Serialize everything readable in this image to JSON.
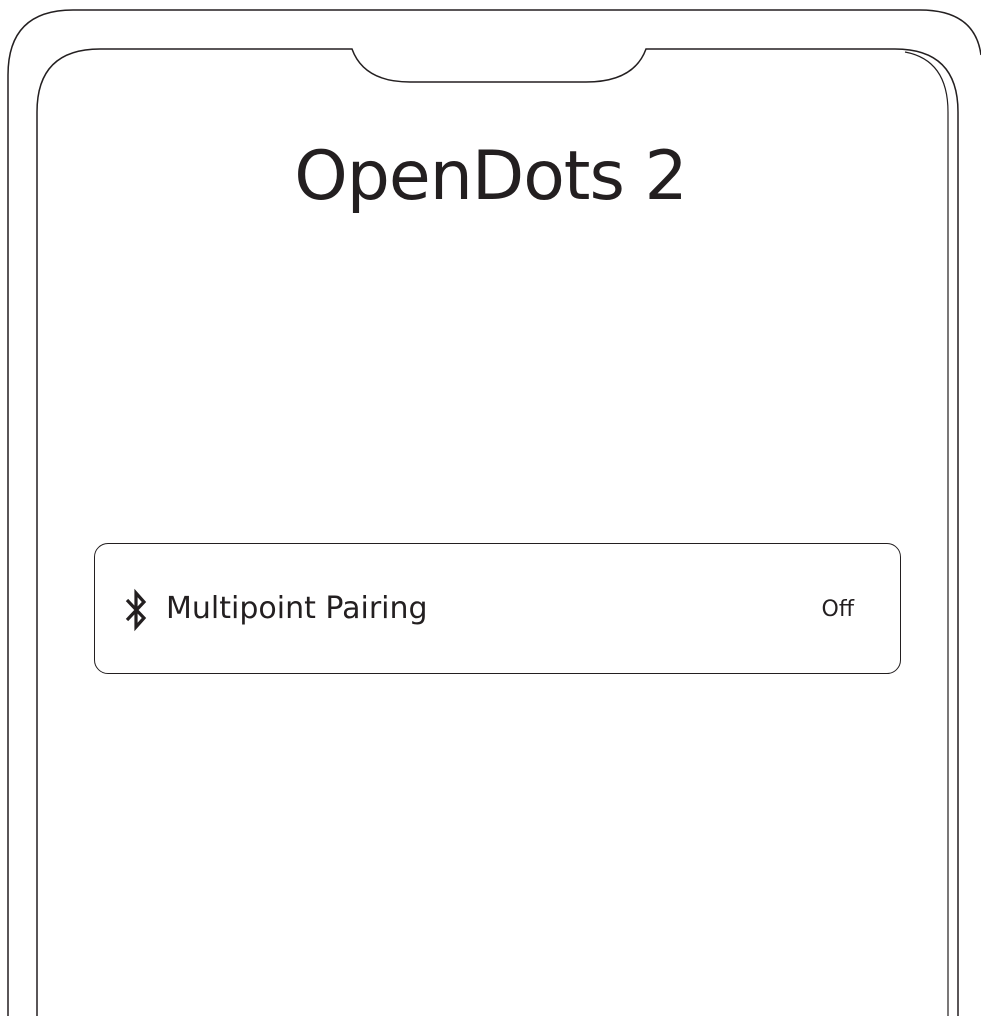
{
  "app": {
    "title": "OpenDots 2"
  },
  "settings": [
    {
      "icon": "bluetooth-icon",
      "label": "Multipoint Pairing",
      "value": "Off"
    }
  ],
  "colors": {
    "ink": "#231f20",
    "background": "#ffffff"
  }
}
